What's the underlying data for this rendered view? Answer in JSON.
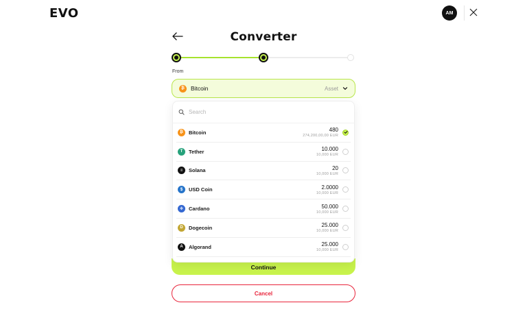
{
  "header": {
    "logo": "EVO",
    "avatar_initials": "AM"
  },
  "page": {
    "title": "Converter",
    "from_label": "From"
  },
  "stepper": {
    "total_steps": 3,
    "current_step": 2
  },
  "asset_select": {
    "selected": "Bitcoin",
    "placeholder": "Asset"
  },
  "search": {
    "placeholder": "Search"
  },
  "assets": [
    {
      "name": "Bitcoin",
      "amount": "480",
      "fiat": "274,200,00,00 EUR",
      "icon": "bitcoin-icon",
      "color": "#f7931a",
      "glyph": "₿",
      "selected": true
    },
    {
      "name": "Tether",
      "amount": "10.000",
      "fiat": "10,000 EUR",
      "icon": "tether-icon",
      "color": "#26a17b",
      "glyph": "T",
      "selected": false
    },
    {
      "name": "Solana",
      "amount": "20",
      "fiat": "10,000 EUR",
      "icon": "solana-icon",
      "color": "#111111",
      "glyph": "≡",
      "selected": false
    },
    {
      "name": "USD Coin",
      "amount": "2.0000",
      "fiat": "10,000 EUR",
      "icon": "usd-coin-icon",
      "color": "#2775ca",
      "glyph": "$",
      "selected": false
    },
    {
      "name": "Cardano",
      "amount": "50.000",
      "fiat": "10,000 EUR",
      "icon": "cardano-icon",
      "color": "#3468d1",
      "glyph": "✻",
      "selected": false
    },
    {
      "name": "Dogecoin",
      "amount": "25.000",
      "fiat": "10,000 EUR",
      "icon": "dogecoin-icon",
      "color": "#c2a633",
      "glyph": "D",
      "selected": false
    },
    {
      "name": "Algorand",
      "amount": "25.000",
      "fiat": "10,000 EUR",
      "icon": "algorand-icon",
      "color": "#111111",
      "glyph": "A",
      "selected": false
    }
  ],
  "buttons": {
    "continue": "Continue",
    "cancel": "Cancel"
  },
  "colors": {
    "accent": "#c8f34c",
    "accent_border": "#b8e64a",
    "danger": "#e8233a"
  }
}
